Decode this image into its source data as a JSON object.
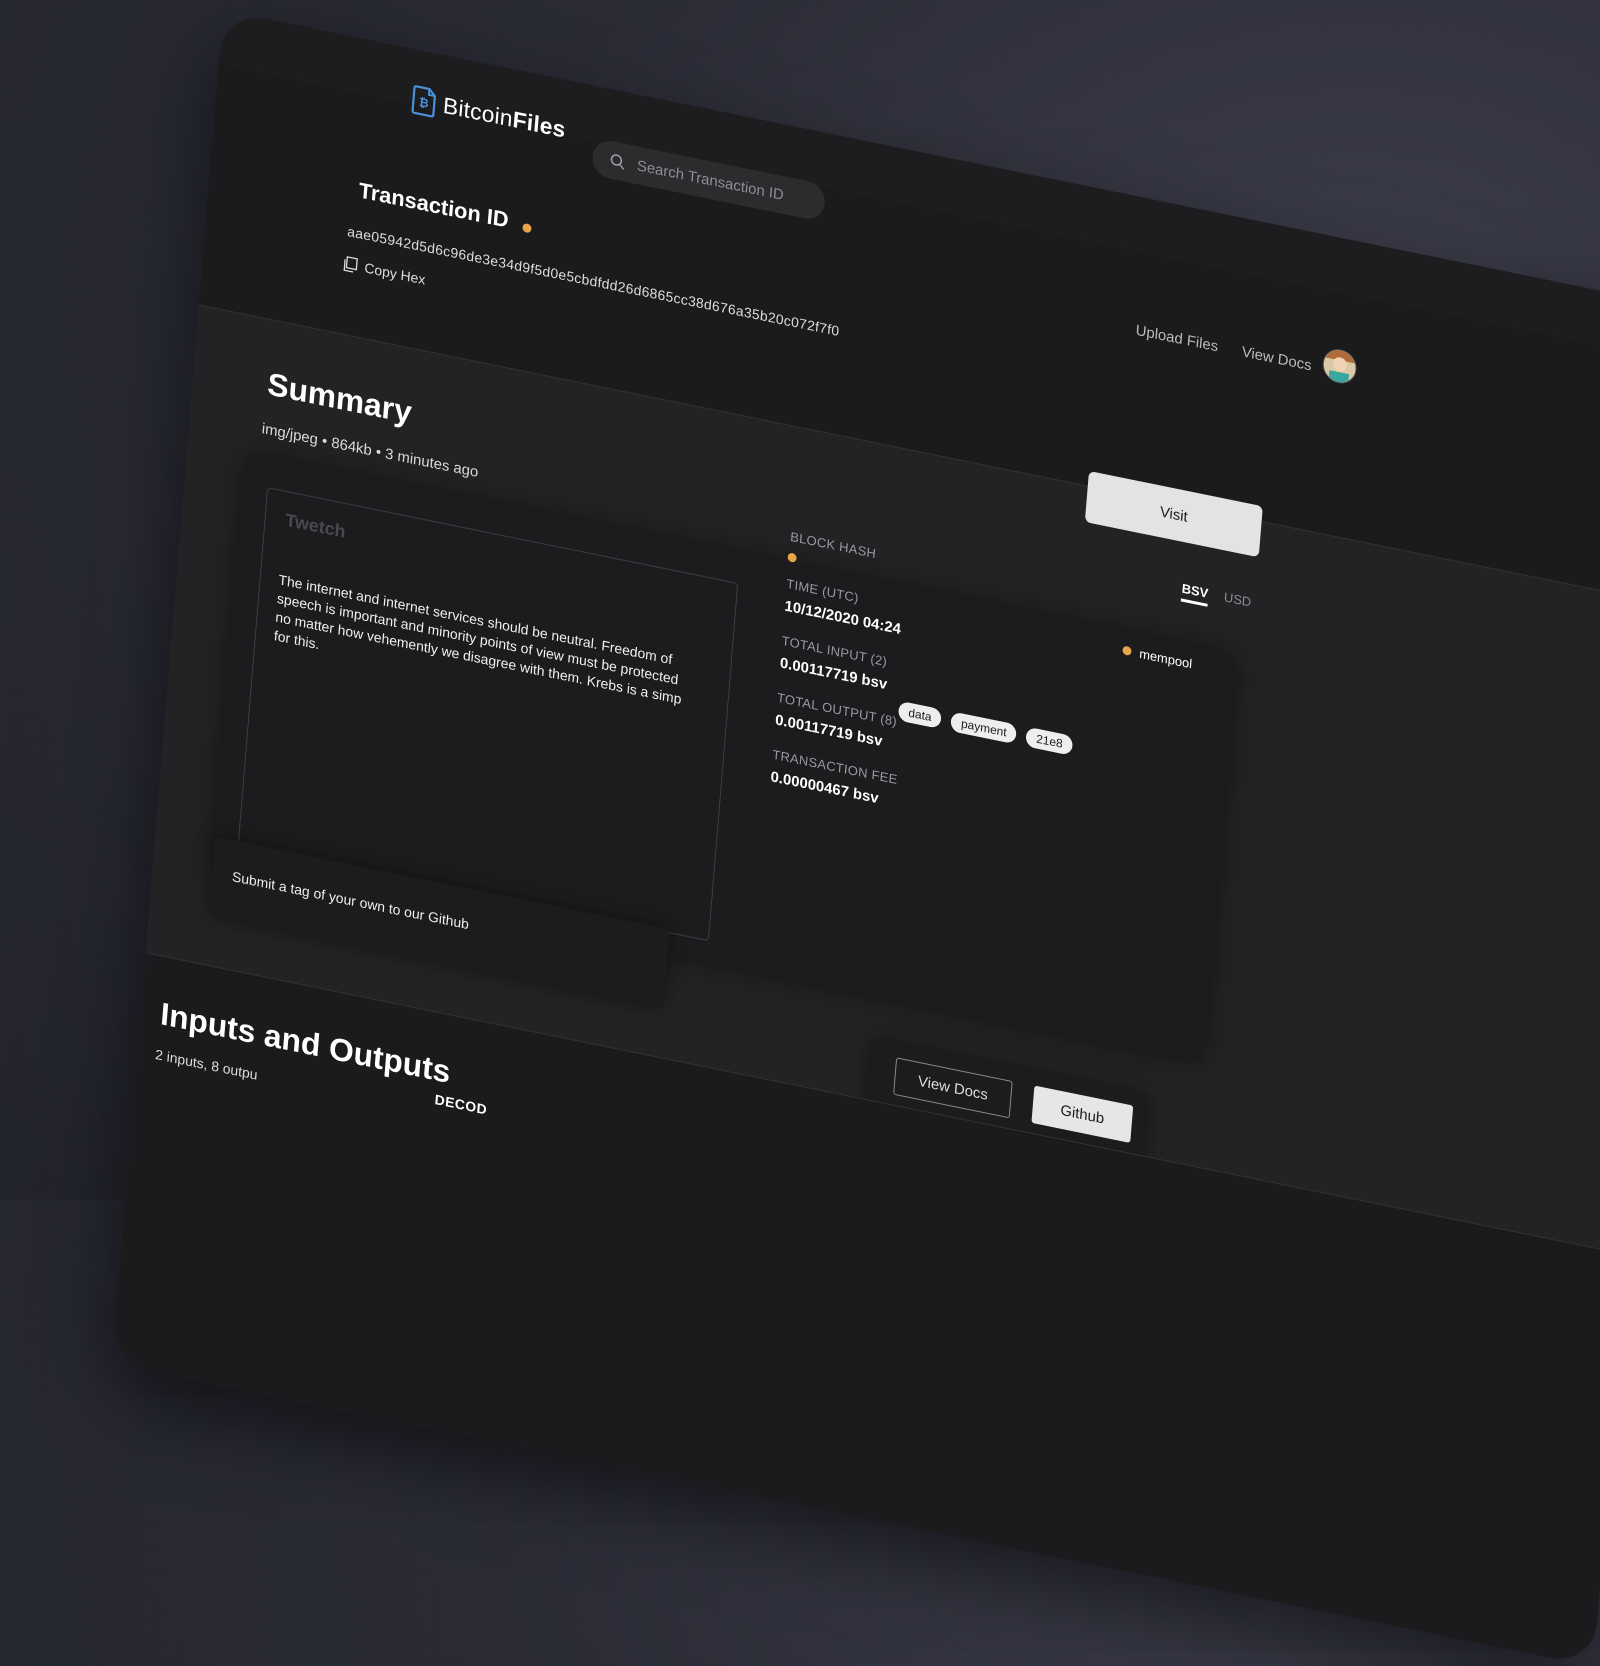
{
  "header": {
    "logo": {
      "text_light": "Bitcoin",
      "text_bold": "Files",
      "icon": "bitcoin-file-icon"
    },
    "search": {
      "placeholder": "Search Transaction ID",
      "icon": "search-icon"
    },
    "nav": {
      "upload_label": "Upload Files",
      "docs_label": "View Docs"
    },
    "avatar": "user-avatar"
  },
  "transaction": {
    "title": "Transaction ID",
    "status_color": "#e8a64a",
    "hash": "aae05942d5d6c96de3e34d9f5d0e5cbdfdd26d6865cc38d676a35b20c072f7f0",
    "copy_label": "Copy Hex"
  },
  "visit_label": "Visit",
  "summary": {
    "title": "Summary",
    "meta": "img/jpeg • 864kb • 3 minutes ago",
    "preview": {
      "brand": "Twetch",
      "text": "The internet and internet services should be neutral. Freedom of speech is important and minority points of view must be protected no matter how vehemently we disagree with them. Krebs is a simp for this."
    },
    "currency_toggle": {
      "active": "BSV",
      "inactive": "USD"
    },
    "block_hash_label": "BLOCK HASH",
    "mempool_label": "mempool",
    "time_label": "TIME (UTC)",
    "time_value": "10/12/2020 04:24",
    "total_input_label": "TOTAL INPUT (2)",
    "total_input_value": "0.00117719 bsv",
    "total_output_label": "TOTAL OUTPUT (8)",
    "total_output_value": "0.00117719 bsv",
    "fee_label": "TRANSACTION FEE",
    "fee_value": "0.00000467 bsv",
    "tags": [
      "data",
      "payment",
      "21e8"
    ]
  },
  "submit_text": "Submit a tag of your own to our Github",
  "buttons": {
    "docs": "View Docs",
    "github": "Github"
  },
  "io": {
    "title": "Inputs and Outputs",
    "meta": "2 inputs, 8 outpu",
    "decode": "DECOD"
  },
  "colors": {
    "accent": "#e8a64a",
    "background": "#232325",
    "panel": "#1c1c1e"
  }
}
